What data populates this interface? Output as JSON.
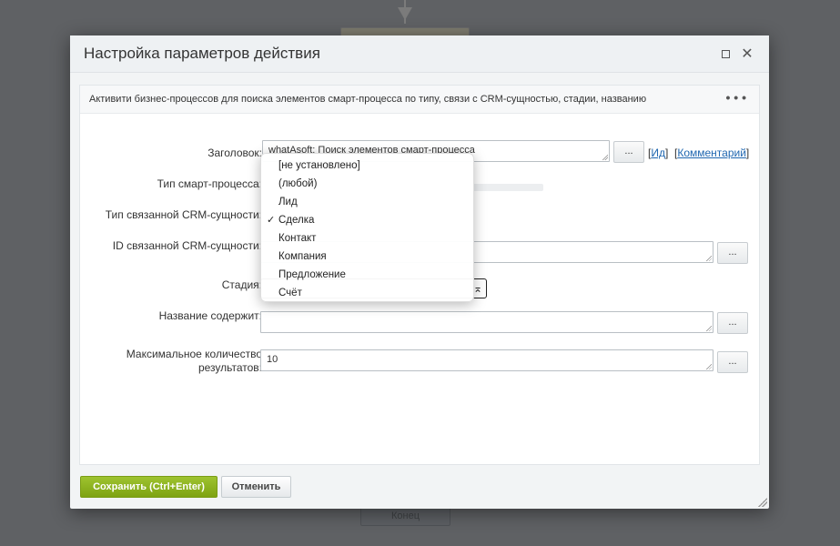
{
  "background": {
    "end_block_label": "Конец"
  },
  "dialog": {
    "title": "Настройка параметров действия"
  },
  "panel": {
    "description": "Активити бизнес-процессов для поиска элементов смарт-процесса по типу, связи с CRM-сущностью, стадии, названию"
  },
  "form": {
    "header_label": "Заголовок:",
    "header_value": "whatAsoft: Поиск элементов смарт-процесса",
    "id_link": "Ид",
    "comment_link": "Комментарий",
    "smart_type_label": "Тип смарт-процесса:",
    "crm_type_label": "Тип связанной CRM-сущности:",
    "crm_id_label": "ID связанной CRM-сущности:",
    "crm_id_value": "",
    "stage_label": "Стадия:",
    "name_label": "Название содержит:",
    "name_value": "",
    "max_label_line1": "Максимальное количество",
    "max_label_line2": "результатов:",
    "max_value": "10",
    "ellipsis": "..."
  },
  "dropdown": {
    "items": [
      "[не установлено]",
      "(любой)",
      "Лид",
      "Сделка",
      "Контакт",
      "Компания",
      "Предложение",
      "Счёт"
    ],
    "selected_index": 3,
    "check_mark": "✓"
  },
  "footer": {
    "save_label": "Сохранить (Ctrl+Enter)",
    "cancel_label": "Отменить"
  },
  "colors": {
    "save_green": "#8cb31f",
    "link_blue": "#2067b0"
  }
}
